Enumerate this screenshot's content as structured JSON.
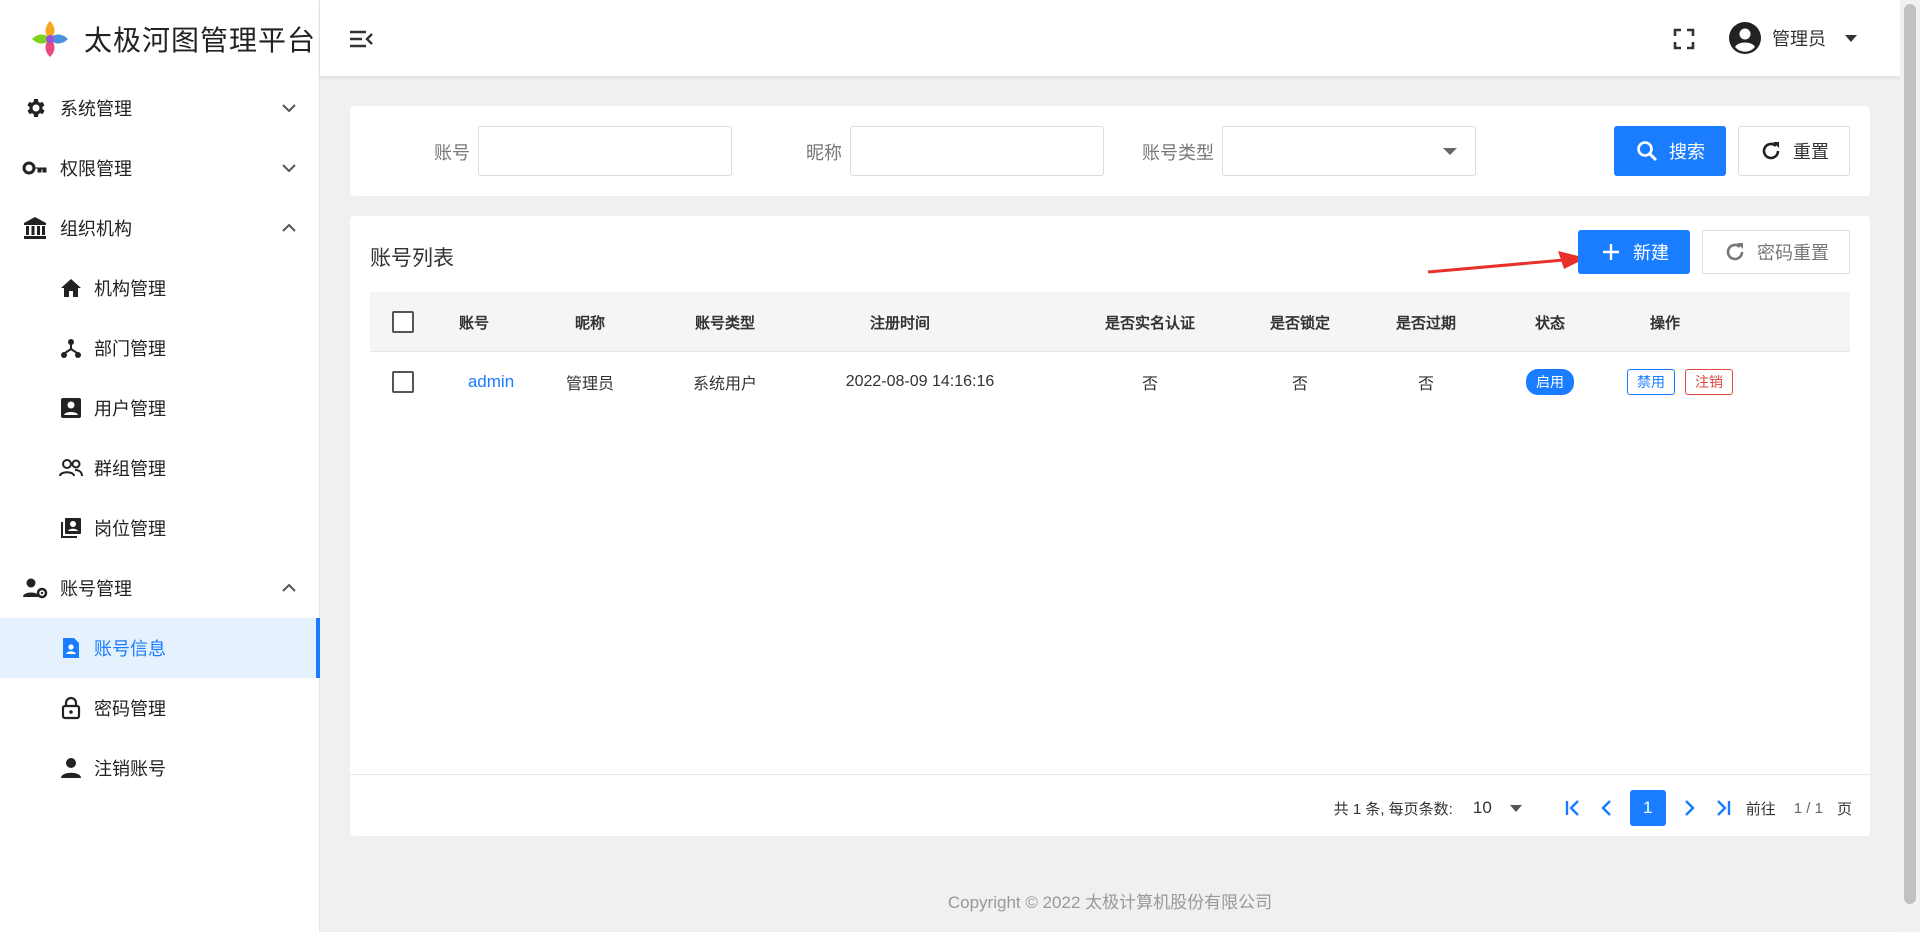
{
  "app": {
    "title": "太极河图管理平台"
  },
  "sidebar": {
    "groups": [
      {
        "label": "系统管理",
        "icon": "gear-icon",
        "expanded": false
      },
      {
        "label": "权限管理",
        "icon": "key-icon",
        "expanded": false
      },
      {
        "label": "组织机构",
        "icon": "bank-icon",
        "expanded": true,
        "items": [
          {
            "label": "机构管理",
            "icon": "home-icon"
          },
          {
            "label": "部门管理",
            "icon": "hierarchy-icon"
          },
          {
            "label": "用户管理",
            "icon": "user-card-icon"
          },
          {
            "label": "群组管理",
            "icon": "users-icon"
          },
          {
            "label": "岗位管理",
            "icon": "position-icon"
          }
        ]
      },
      {
        "label": "账号管理",
        "icon": "user-gear-icon",
        "expanded": true,
        "items": [
          {
            "label": "账号信息",
            "icon": "account-file-icon",
            "active": true
          },
          {
            "label": "密码管理",
            "icon": "lock-icon"
          },
          {
            "label": "注销账号",
            "icon": "person-icon"
          }
        ]
      }
    ]
  },
  "header": {
    "user_name": "管理员"
  },
  "search": {
    "account_label": "账号",
    "account_value": "",
    "nickname_label": "昵称",
    "nickname_value": "",
    "type_label": "账号类型",
    "type_value": "",
    "search_button": "搜索",
    "reset_button": "重置"
  },
  "list": {
    "title": "账号列表",
    "new_button": "新建",
    "password_reset_button": "密码重置",
    "columns": [
      "账号",
      "昵称",
      "账号类型",
      "注册时间",
      "是否实名认证",
      "是否锁定",
      "是否过期",
      "状态",
      "操作"
    ],
    "rows": [
      {
        "account": "admin",
        "nickname": "管理员",
        "type": "系统用户",
        "registered": "2022-08-09 14:16:16",
        "verified": "否",
        "locked": "否",
        "expired": "否",
        "status": "启用",
        "actions": [
          "禁用",
          "注销"
        ]
      }
    ]
  },
  "pagination": {
    "total_text": "共 1 条, 每页条数:",
    "page_size": "10",
    "current_page": "1",
    "goto_label": "前往",
    "page_info": "1 / 1",
    "page_unit": "页"
  },
  "footer": {
    "copyright": "Copyright © 2022 太极计算机股份有限公司"
  },
  "colors": {
    "primary": "#1a7cff",
    "danger": "#e0473d",
    "annotation_arrow": "#e8312a"
  }
}
